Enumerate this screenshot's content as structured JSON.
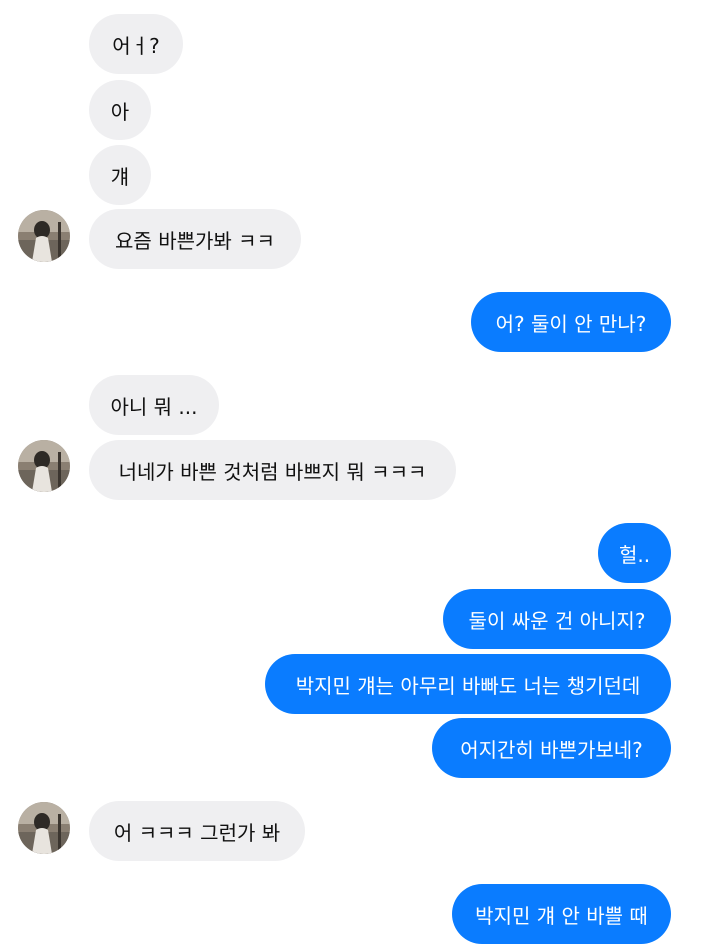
{
  "colors": {
    "incoming_bubble": "#efeff1",
    "outgoing_bubble": "#0a7cff",
    "incoming_text": "#111111",
    "outgoing_text": "#ffffff"
  },
  "messages": [
    {
      "sender": "other",
      "text": "어ㅓ?"
    },
    {
      "sender": "other",
      "text": "아"
    },
    {
      "sender": "other",
      "text": "걔"
    },
    {
      "sender": "other",
      "text": "요즘 바쁜가봐 ㅋㅋ",
      "avatar": "profile-photo"
    },
    {
      "sender": "me",
      "text": "어? 둘이 안 만나?"
    },
    {
      "sender": "other",
      "text": "아니 뭐 ..."
    },
    {
      "sender": "other",
      "text": "너네가 바쁜 것처럼 바쁘지 뭐 ㅋㅋㅋ",
      "avatar": "profile-photo"
    },
    {
      "sender": "me",
      "text": "헐.."
    },
    {
      "sender": "me",
      "text": "둘이 싸운 건 아니지?"
    },
    {
      "sender": "me",
      "text": "박지민 걔는 아무리 바빠도 너는 챙기던데"
    },
    {
      "sender": "me",
      "text": "어지간히 바쁜가보네?"
    },
    {
      "sender": "other",
      "text": "어 ㅋㅋㅋ 그런가 봐",
      "avatar": "profile-photo"
    },
    {
      "sender": "me",
      "text": "박지민 걔 안 바쁠 때"
    }
  ]
}
